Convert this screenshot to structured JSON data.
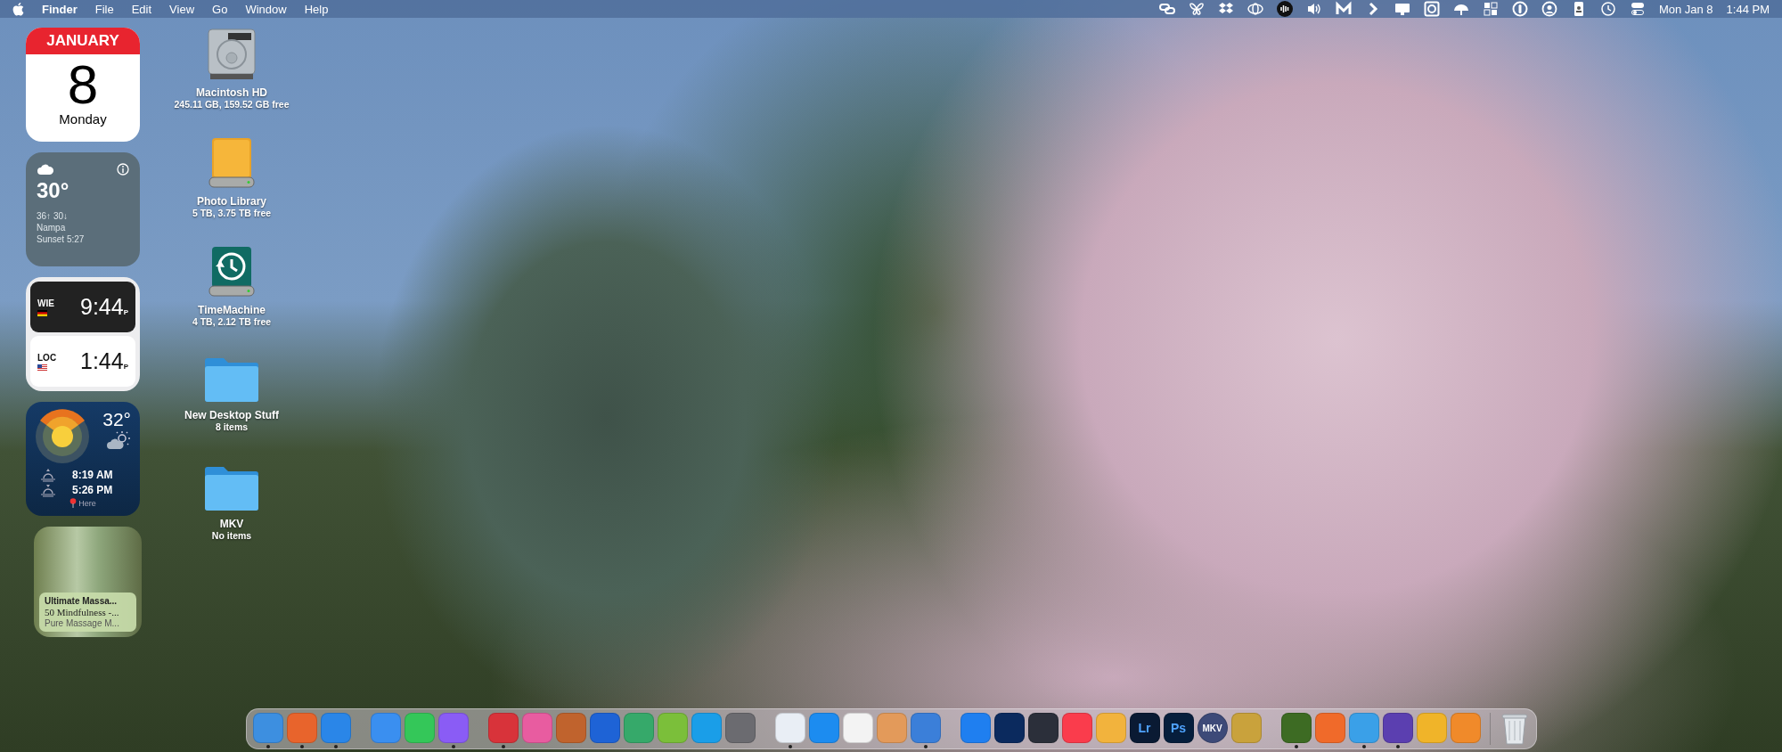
{
  "menu_bar": {
    "app_name": "Finder",
    "menus": [
      "File",
      "Edit",
      "View",
      "Go",
      "Window",
      "Help"
    ],
    "date": "Mon Jan 8",
    "time": "1:44 PM"
  },
  "widgets": {
    "calendar": {
      "month": "JANUARY",
      "day": "8",
      "weekday": "Monday"
    },
    "weather": {
      "temperature": "30°",
      "high_low": "36↑ 30↓",
      "location": "Nampa",
      "sunset": "Sunset 5:27"
    },
    "world_clock": [
      {
        "city": "WIE",
        "time": "9:44",
        "period": "P",
        "kind": "night"
      },
      {
        "city": "LOC",
        "time": "1:44",
        "period": "P",
        "kind": "day"
      }
    ],
    "sun": {
      "temperature": "32°",
      "sunrise": "8:19 AM",
      "sunset": "5:26 PM",
      "location": "Here"
    },
    "now_playing": {
      "title": "Ultimate Massa...",
      "subtitle": "50 Mindfulness -...",
      "artist": "Pure Massage M..."
    }
  },
  "desktop_icons": [
    {
      "kind": "hdd",
      "name": "Macintosh HD",
      "info": "245.11 GB, 159.52 GB free"
    },
    {
      "kind": "external",
      "name": "Photo Library",
      "info": "5 TB, 3.75 TB free"
    },
    {
      "kind": "timemachine",
      "name": "TimeMachine",
      "info": "4 TB, 2.12 TB free"
    },
    {
      "kind": "folder",
      "name": "New Desktop Stuff",
      "info": "8 items"
    },
    {
      "kind": "folder",
      "name": "MKV",
      "info": "No items"
    }
  ],
  "dock": {
    "items": [
      {
        "kind": "app",
        "color": "#3d8fe0",
        "running": true
      },
      {
        "kind": "app",
        "color": "#e8642c",
        "running": true
      },
      {
        "kind": "app",
        "color": "#2a86e8",
        "running": true
      },
      {
        "kind": "spacer"
      },
      {
        "kind": "app",
        "color": "#3a8ff0",
        "running": false
      },
      {
        "kind": "app",
        "color": "#34c759",
        "running": false
      },
      {
        "kind": "app",
        "color": "#8a5cf5",
        "running": true
      },
      {
        "kind": "spacer"
      },
      {
        "kind": "app",
        "color": "#d8333a",
        "running": true
      },
      {
        "kind": "app",
        "color": "#e85ca0",
        "running": false
      },
      {
        "kind": "app",
        "color": "#c0632d",
        "running": false
      },
      {
        "kind": "app",
        "color": "#1e63d6",
        "running": false
      },
      {
        "kind": "app",
        "color": "#36a96a",
        "running": false
      },
      {
        "kind": "app",
        "color": "#7bbf3a",
        "running": false
      },
      {
        "kind": "app",
        "color": "#1a9ee8",
        "running": false
      },
      {
        "kind": "app",
        "color": "#6b6b70",
        "running": false
      },
      {
        "kind": "spacer"
      },
      {
        "kind": "app",
        "color": "#e9eef5",
        "running": true
      },
      {
        "kind": "app",
        "color": "#1c8cf0",
        "running": false
      },
      {
        "kind": "app",
        "color": "#f3f3f3",
        "running": false
      },
      {
        "kind": "app",
        "color": "#e39a5a",
        "running": false
      },
      {
        "kind": "app",
        "color": "#3b7fd9",
        "running": true
      },
      {
        "kind": "spacer"
      },
      {
        "kind": "app",
        "color": "#1f7ff0",
        "running": false
      },
      {
        "kind": "app",
        "color": "#0b2a5e",
        "running": false
      },
      {
        "kind": "app",
        "color": "#2b2f3a",
        "running": false
      },
      {
        "kind": "app",
        "color": "#fa3c4c",
        "running": false
      },
      {
        "kind": "app",
        "color": "#f2b33d",
        "running": false
      },
      {
        "kind": "app",
        "color": "#0a1a33",
        "label": "Lr",
        "running": false
      },
      {
        "kind": "app",
        "color": "#061e3c",
        "label": "Ps",
        "running": false
      },
      {
        "kind": "app",
        "color": "#3d4a78",
        "label": "MKV",
        "running": false
      },
      {
        "kind": "app",
        "color": "#c9a23c",
        "running": false
      },
      {
        "kind": "spacer"
      },
      {
        "kind": "app",
        "color": "#3d6b23",
        "running": true
      },
      {
        "kind": "app",
        "color": "#f06a2a",
        "running": false
      },
      {
        "kind": "app",
        "color": "#3aa0e8",
        "running": true
      },
      {
        "kind": "app",
        "color": "#5b3fb0",
        "running": true
      },
      {
        "kind": "app",
        "color": "#f0b429",
        "running": false
      },
      {
        "kind": "app",
        "color": "#f08a2a",
        "running": false
      },
      {
        "kind": "divider"
      },
      {
        "kind": "trash"
      }
    ]
  }
}
